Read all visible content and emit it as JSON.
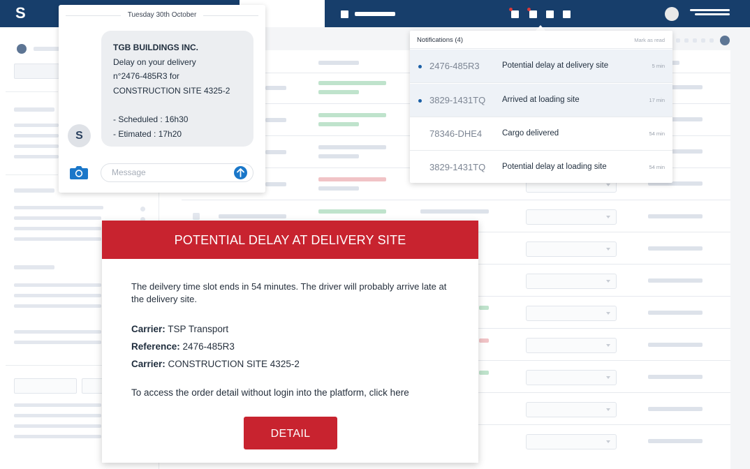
{
  "topbar": {
    "logo": "S"
  },
  "chat": {
    "date": "Tuesday 30th October",
    "message": {
      "company": "TGB BUILDINGS INC.",
      "line1": "Delay on your delivery",
      "line2": "n°2476-485R3 for",
      "line3": "CONSTRUCTION SITE 4325-2",
      "scheduled": "- Scheduled : 16h30",
      "estimated": "- Etimated : 17h20"
    },
    "avatar_initial": "S",
    "input_placeholder": "Message"
  },
  "notifications": {
    "title": "Notifications (4)",
    "mark_read": "Mark as read",
    "items": [
      {
        "ref": "2476-485R3",
        "text": "Potential delay at delivery site",
        "time": "5 min",
        "unread": true
      },
      {
        "ref": "3829-1431TQ",
        "text": "Arrived at loading site",
        "time": "17 min",
        "unread": true
      },
      {
        "ref": "78346-DHE4",
        "text": "Cargo delivered",
        "time": "54 min",
        "unread": false
      },
      {
        "ref": "3829-1431TQ",
        "text": "Potential delay at loading site",
        "time": "54 min",
        "unread": false
      }
    ]
  },
  "alert": {
    "title": "POTENTIAL DELAY AT DELIVERY SITE",
    "body": "The deilvery time slot ends in 54 minutes. The driver will probably arrive late at the delivery site.",
    "carrier_label": "Carrier:",
    "carrier_value": "TSP Transport",
    "reference_label": "Reference:",
    "reference_value": "2476-485R3",
    "site_label": "Carrier:",
    "site_value": "CONSTRUCTION SITE 4325-2",
    "link_text": "To access the order detail without login into the platform, click here",
    "button_label": "DETAIL"
  },
  "colors": {
    "navy": "#173e6b",
    "alert_red": "#c8232f",
    "link_blue": "#1a77c9"
  }
}
